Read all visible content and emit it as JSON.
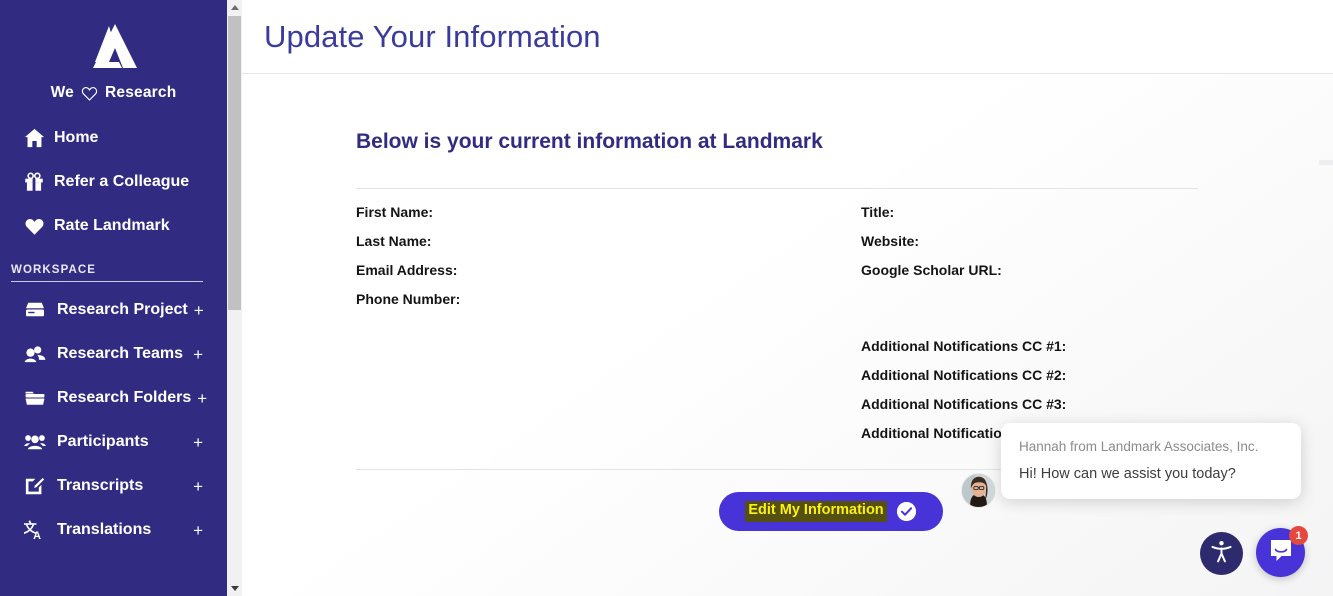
{
  "sidebar": {
    "logo_icon": "landmark-logo-icon",
    "brand": {
      "prefix": "We",
      "heart_icon": "heart-outline-icon",
      "suffix": "Research"
    },
    "nav": [
      {
        "label": "Home",
        "icon": "home-icon"
      },
      {
        "label": "Refer a Colleague",
        "icon": "gift-icon"
      },
      {
        "label": "Rate Landmark",
        "icon": "heart-filled-icon"
      }
    ],
    "workspace": {
      "header": "WORKSPACE",
      "items": [
        {
          "label": "Research Project",
          "icon": "server-icon",
          "plus": "+"
        },
        {
          "label": "Research Teams",
          "icon": "users-two-icon",
          "plus": "+"
        },
        {
          "label": "Research Folders",
          "icon": "folder-icon",
          "plus": "+"
        },
        {
          "label": "Participants",
          "icon": "users-group-icon",
          "plus": "+"
        },
        {
          "label": "Transcripts",
          "icon": "edit-square-icon",
          "plus": "+"
        },
        {
          "label": "Translations",
          "icon": "translate-icon",
          "plus": "+"
        }
      ]
    },
    "scrollbar": {
      "up_icon": "scroll-up-arrow-icon",
      "down_icon": "scroll-down-arrow-icon"
    }
  },
  "header": {
    "title": "Update Your Information"
  },
  "main": {
    "section_title": "Below is your current information at Landmark",
    "fields_left": [
      {
        "label": "First Name:",
        "value": ""
      },
      {
        "label": "Last Name:",
        "value": ""
      },
      {
        "label": "Email Address:",
        "value": ""
      },
      {
        "label": "Phone Number:",
        "value": ""
      }
    ],
    "fields_right": [
      {
        "label": "Title:",
        "value": ""
      },
      {
        "label": "Website:",
        "value": ""
      },
      {
        "label": "Google Scholar URL:",
        "value": ""
      }
    ],
    "fields_right_cc": [
      {
        "label": "Additional Notifications CC #1:",
        "value": ""
      },
      {
        "label": "Additional Notifications CC #2:",
        "value": ""
      },
      {
        "label": "Additional Notifications CC #3:",
        "value": ""
      },
      {
        "label": "Additional Notifications CC #4:",
        "value": ""
      }
    ],
    "edit_button": {
      "label": "Edit My Information",
      "check_icon": "check-circle-icon",
      "bg_color": "#4833d8",
      "highlight_color": "#55500f",
      "text_color": "#fcf113"
    }
  },
  "chat": {
    "avatar_icon": "agent-avatar-icon",
    "from": "Hannah from Landmark Associates, Inc.",
    "message": "Hi! How can we assist you today?",
    "launcher_icon": "intercom-chat-icon",
    "badge_count": "1",
    "accessibility_icon": "accessibility-icon"
  },
  "colors": {
    "sidebar_bg": "#312C82",
    "title": "#3b3b9e",
    "section_title": "#312C82",
    "accent": "#4833d8",
    "badge": "#e6483d"
  }
}
